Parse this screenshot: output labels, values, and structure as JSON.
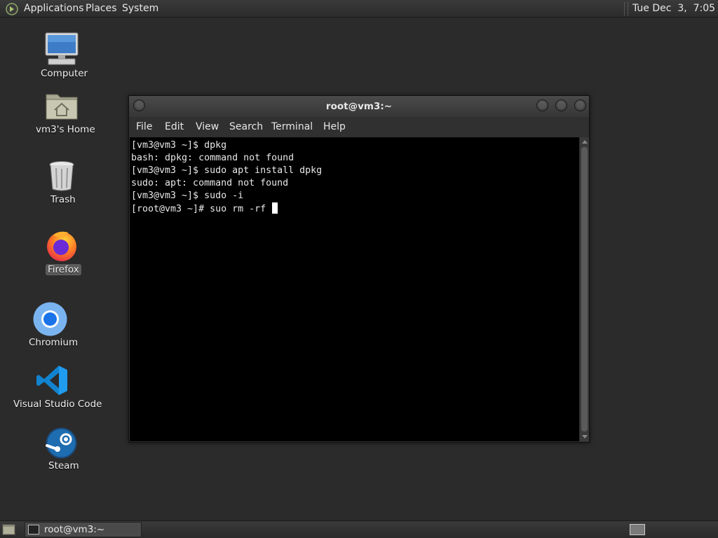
{
  "top_panel": {
    "menus": [
      "Applications",
      "Places",
      "System"
    ],
    "clock": "Tue Dec  3,  7:05 PM"
  },
  "desktop_icons": [
    {
      "label": "Computer",
      "icon": "computer-icon"
    },
    {
      "label": "vm3's Home",
      "icon": "home-folder-icon"
    },
    {
      "label": "Trash",
      "icon": "trash-icon"
    },
    {
      "label": "Firefox",
      "icon": "firefox-icon",
      "selected": true
    },
    {
      "label": "Chromium",
      "icon": "chromium-icon"
    },
    {
      "label": "Visual Studio Code",
      "icon": "vscode-icon"
    },
    {
      "label": "Steam",
      "icon": "steam-icon"
    }
  ],
  "terminal": {
    "title": "root@vm3:~",
    "menus": [
      "File",
      "Edit",
      "View",
      "Search",
      "Terminal",
      "Help"
    ],
    "lines": [
      "[vm3@vm3 ~]$ dpkg",
      "bash: dpkg: command not found",
      "[vm3@vm3 ~]$ sudo apt install dpkg",
      "sudo: apt: command not found",
      "[vm3@vm3 ~]$ sudo -i",
      "[root@vm3 ~]# suo rm -rf "
    ]
  },
  "bottom_panel": {
    "task_label": "root@vm3:~"
  },
  "colors": {
    "desktop_bg": "#2b2b2b",
    "terminal_bg": "#000000",
    "terminal_fg": "#e8e8e8"
  }
}
